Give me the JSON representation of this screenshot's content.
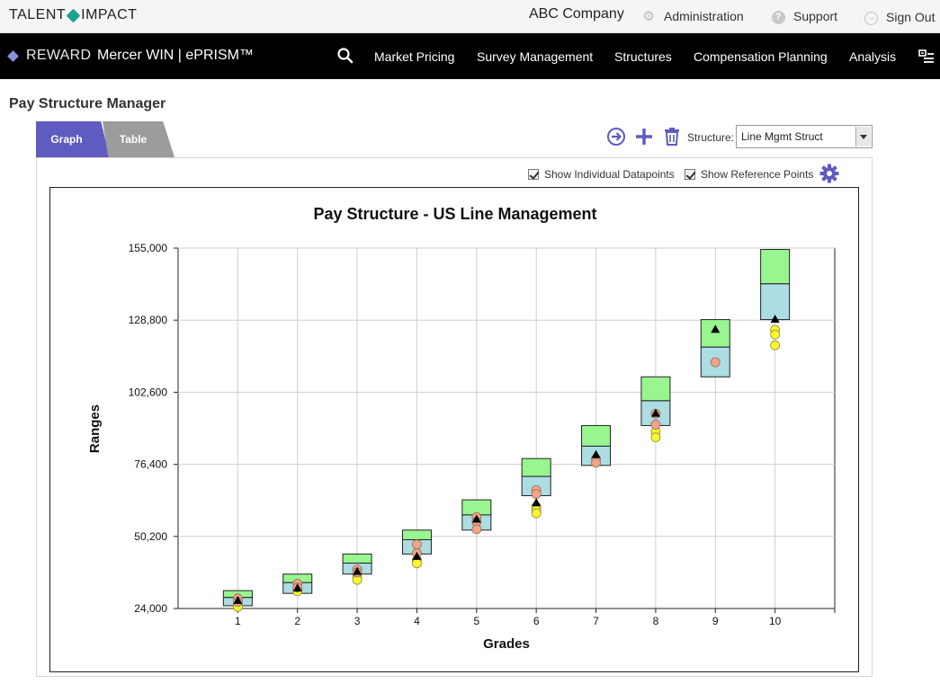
{
  "header": {
    "brand_left": "TALENT",
    "brand_right": "IMPACT",
    "company": "ABC Company",
    "links": [
      {
        "label": "Administration",
        "icon": "gear-icon"
      },
      {
        "label": "Support",
        "icon": "help-icon"
      },
      {
        "label": "Sign Out",
        "icon": "sign-out-icon"
      }
    ]
  },
  "nav": {
    "logo_label": "REWARD",
    "product": "Mercer WIN | ePRISM™",
    "items": [
      "Market Pricing",
      "Survey Management",
      "Structures",
      "Compensation Planning",
      "Analysis"
    ]
  },
  "page": {
    "title": "Pay Structure Manager",
    "tabs": [
      {
        "label": "Graph",
        "active": true
      },
      {
        "label": "Table",
        "active": false
      }
    ],
    "structure_label": "Structure:",
    "structure_value": "Line Mgmt Struct",
    "options": [
      {
        "label": "Show Individual Datapoints",
        "checked": true
      },
      {
        "label": "Show Reference Points",
        "checked": true
      }
    ]
  },
  "colors": {
    "upper_range": "#99f58f",
    "lower_range": "#abdde2",
    "datapoint_salmon": "#f2a488",
    "datapoint_yellow": "#fcf62a",
    "reference_triangle": "#000000",
    "tab_active": "#5f5bc0",
    "tab_inactive": "#9c9c9c",
    "icon_accent": "#5f5bc0"
  },
  "chart_data": {
    "type": "range-box",
    "title": "Pay Structure - US Line Management",
    "xlabel": "Grades",
    "ylabel": "Ranges",
    "ylim": [
      24000,
      155000
    ],
    "yticks": [
      24000,
      50200,
      76400,
      102600,
      128800,
      155000
    ],
    "ytick_labels": [
      "24,000",
      "50,200",
      "76,400",
      "102,600",
      "128,800",
      "155,000"
    ],
    "grid": true,
    "grades": [
      {
        "grade": "1",
        "min": 25000,
        "mid": 28000,
        "max": 30500,
        "reference": 27000,
        "salmon": [
          27700,
          26400
        ],
        "yellow": [
          25400,
          24600
        ]
      },
      {
        "grade": "2",
        "min": 29500,
        "mid": 33400,
        "max": 36500,
        "reference": 31500,
        "salmon": [
          33000,
          31600
        ],
        "yellow": [
          30800,
          30300
        ]
      },
      {
        "grade": "3",
        "min": 36500,
        "mid": 40500,
        "max": 43800,
        "reference": 37500,
        "salmon": [
          38200,
          37100
        ],
        "yellow": [
          35600,
          34400
        ]
      },
      {
        "grade": "4",
        "min": 43800,
        "mid": 49000,
        "max": 52500,
        "reference": 43000,
        "salmon": [
          47300,
          44100
        ],
        "yellow": [
          41600,
          40400
        ]
      },
      {
        "grade": "5",
        "min": 52500,
        "mid": 58000,
        "max": 63500,
        "reference": 56500,
        "salmon": [
          57200,
          55500,
          52800
        ],
        "yellow": []
      },
      {
        "grade": "6",
        "min": 65000,
        "mid": 72000,
        "max": 78500,
        "reference": 62500,
        "salmon": [
          67000,
          65600
        ],
        "yellow": [
          61000,
          59600,
          58600
        ]
      },
      {
        "grade": "7",
        "min": 76000,
        "mid": 83000,
        "max": 90500,
        "reference": 80000,
        "salmon": [
          78300,
          77000
        ],
        "yellow": []
      },
      {
        "grade": "8",
        "min": 90500,
        "mid": 99500,
        "max": 108200,
        "reference": 95000,
        "salmon": [
          94800,
          90800
        ],
        "yellow": [
          88300,
          86200
        ]
      },
      {
        "grade": "9",
        "min": 108200,
        "mid": 119000,
        "max": 129000,
        "reference": 125500,
        "salmon": [
          113500
        ],
        "yellow": []
      },
      {
        "grade": "10",
        "min": 129000,
        "mid": 142000,
        "max": 154500,
        "reference": 129200,
        "salmon": [],
        "yellow": [
          125300,
          123600,
          119700
        ]
      }
    ]
  }
}
